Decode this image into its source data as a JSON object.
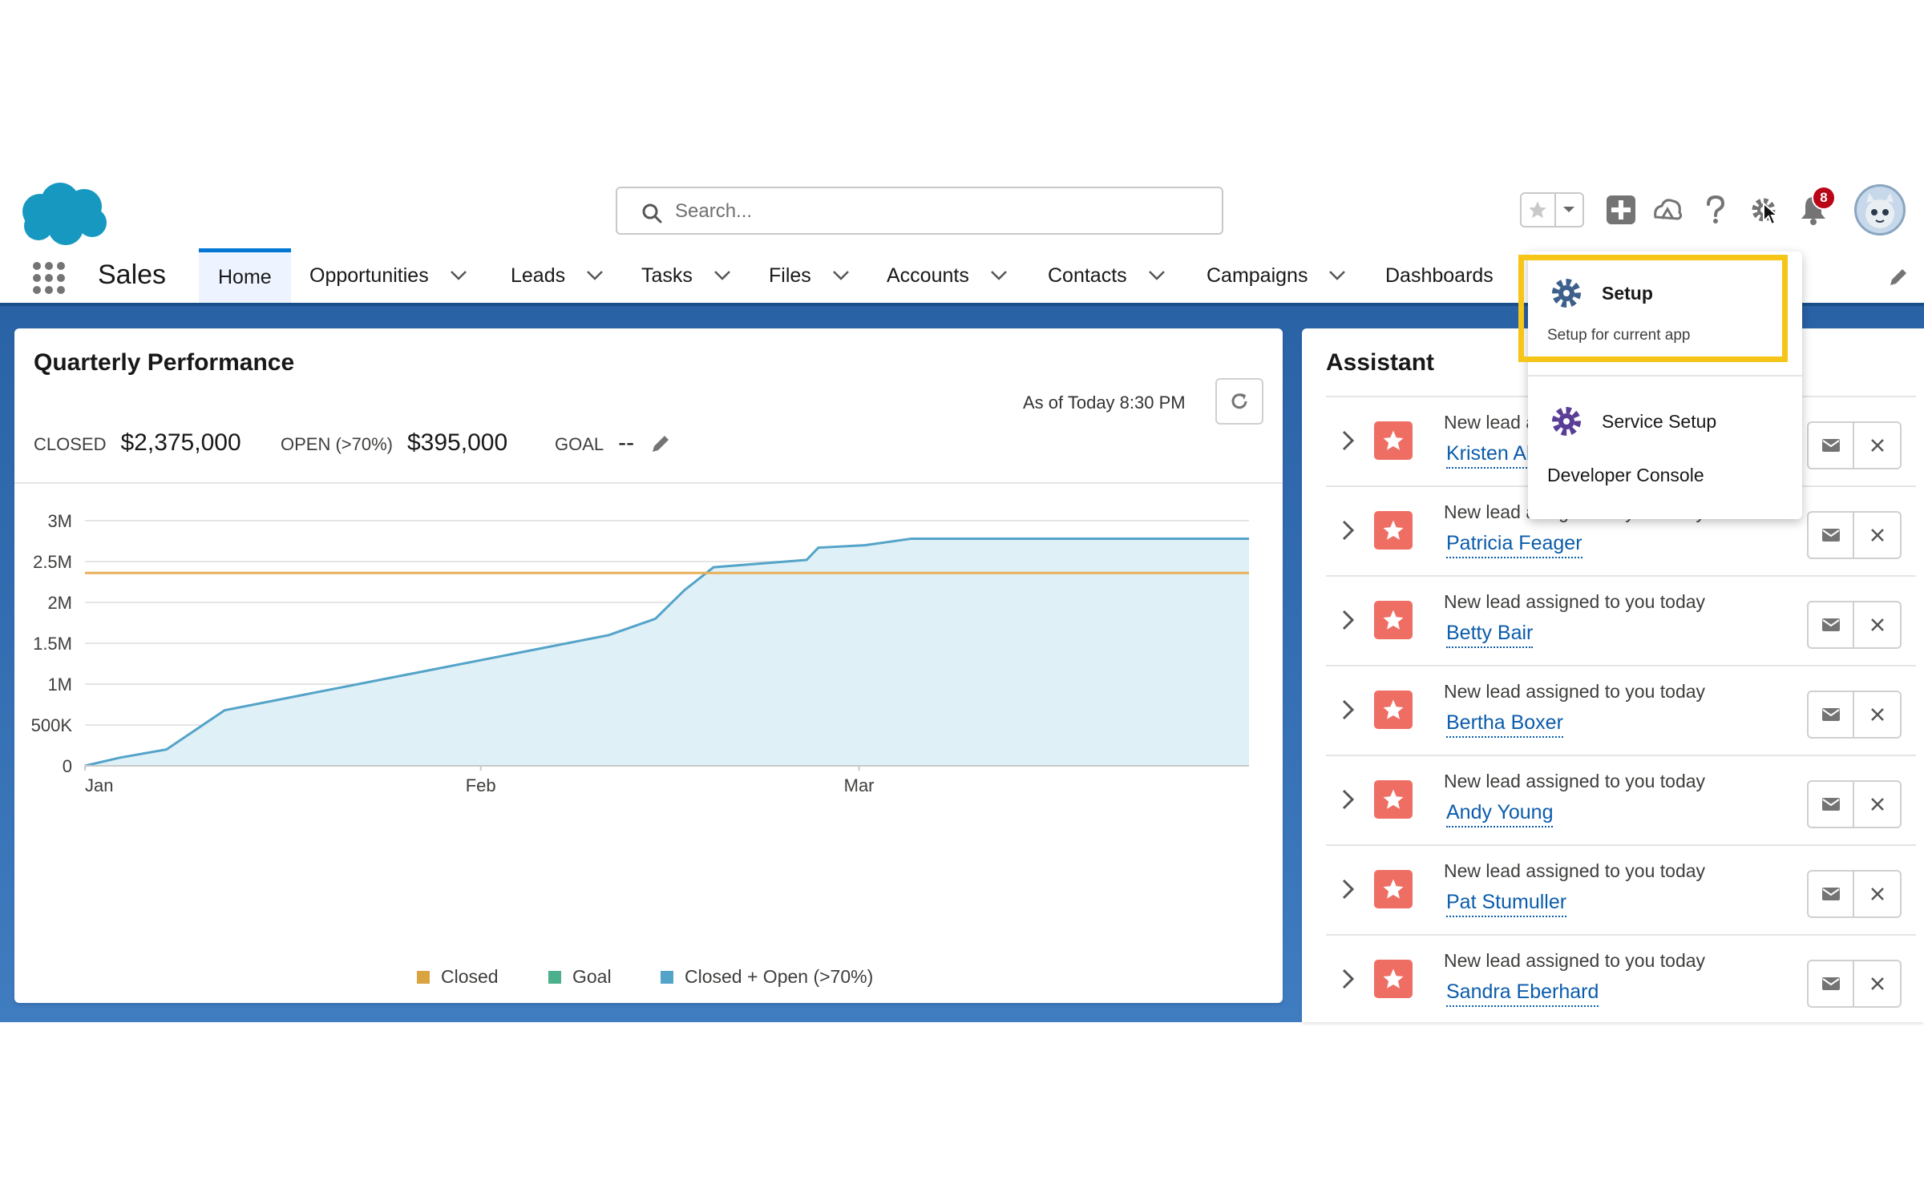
{
  "header": {
    "search_placeholder": "Search...",
    "notification_count": "8"
  },
  "nav": {
    "app_name": "Sales",
    "tabs": [
      {
        "label": "Home"
      },
      {
        "label": "Opportunities"
      },
      {
        "label": "Leads"
      },
      {
        "label": "Tasks"
      },
      {
        "label": "Files"
      },
      {
        "label": "Accounts"
      },
      {
        "label": "Contacts"
      },
      {
        "label": "Campaigns"
      },
      {
        "label": "Dashboards"
      }
    ]
  },
  "quarterly": {
    "title": "Quarterly Performance",
    "as_of": "As of Today 8:30 PM",
    "closed_label": "CLOSED",
    "closed_value": "$2,375,000",
    "open_label": "OPEN (>70%)",
    "open_value": "$395,000",
    "goal_label": "GOAL",
    "goal_value": "--"
  },
  "chart_data": {
    "type": "area",
    "x_ticks": [
      "Jan",
      "Feb",
      "Mar"
    ],
    "y_ticks": [
      "0",
      "500K",
      "1M",
      "1.5M",
      "2M",
      "2.5M",
      "3M"
    ],
    "ylim": [
      0,
      3000000
    ],
    "series": [
      {
        "name": "Closed",
        "color": "#d9a441",
        "values": []
      },
      {
        "name": "Goal",
        "color": "#4bb08c",
        "values": [
          2360000
        ]
      },
      {
        "name": "Closed + Open (>70%)",
        "color": "#54a3c8",
        "points": [
          [
            0,
            0
          ],
          [
            0.03,
            100000
          ],
          [
            0.07,
            200000
          ],
          [
            0.12,
            680000
          ],
          [
            0.45,
            1600000
          ],
          [
            0.49,
            1800000
          ],
          [
            0.515,
            2150000
          ],
          [
            0.54,
            2430000
          ],
          [
            0.62,
            2520000
          ],
          [
            0.63,
            2670000
          ],
          [
            0.67,
            2700000
          ],
          [
            0.71,
            2780000
          ],
          [
            1.0,
            2780000
          ]
        ]
      }
    ],
    "legend": [
      "Closed",
      "Goal",
      "Closed + Open (>70%)"
    ]
  },
  "assistant": {
    "title": "Assistant",
    "items": [
      {
        "message": "New lead assigned to you today",
        "name": "Kristen Akin"
      },
      {
        "message": "New lead assigned to you today",
        "name": "Patricia Feager"
      },
      {
        "message": "New lead assigned to you today",
        "name": "Betty Bair"
      },
      {
        "message": "New lead assigned to you today",
        "name": "Bertha Boxer"
      },
      {
        "message": "New lead assigned to you today",
        "name": "Andy Young"
      },
      {
        "message": "New lead assigned to you today",
        "name": "Pat Stumuller"
      },
      {
        "message": "New lead assigned to you today",
        "name": "Sandra Eberhard"
      }
    ]
  },
  "setup_menu": {
    "setup_label": "Setup",
    "setup_sub": "Setup for current app",
    "service_setup_label": "Service Setup",
    "developer_console_label": "Developer Console"
  },
  "colors": {
    "brand_blue": "#0176d3",
    "highlight": "#f5c518",
    "lead_icon": "#ef6e64",
    "link": "#0b5cab"
  }
}
